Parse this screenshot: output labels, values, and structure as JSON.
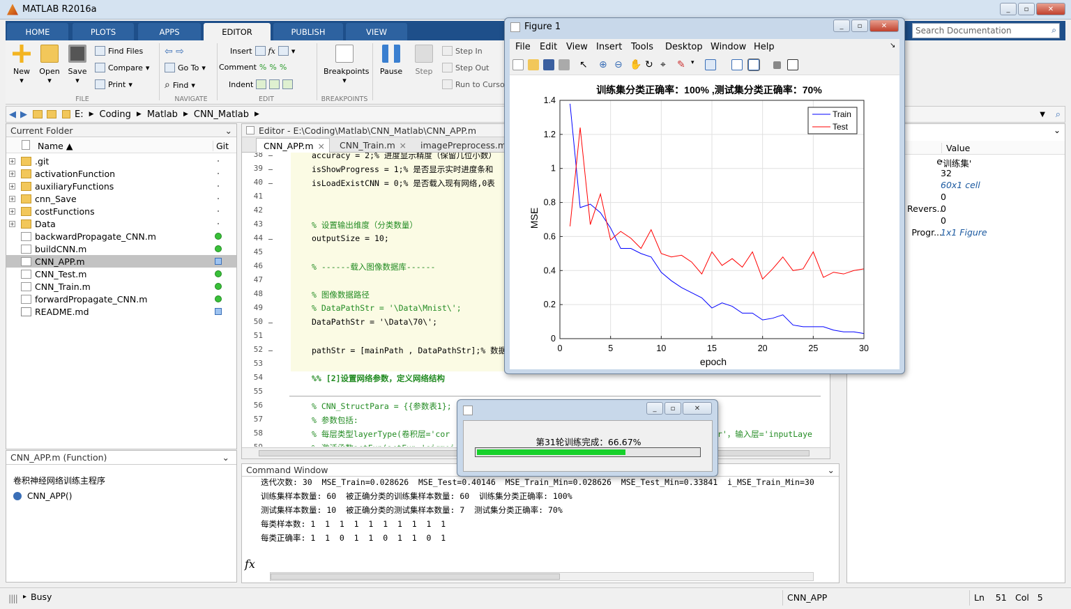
{
  "app": {
    "title": "MATLAB R2016a",
    "search_placeholder": "Search Documentation"
  },
  "ribbon": {
    "tabs": [
      "HOME",
      "PLOTS",
      "APPS",
      "EDITOR",
      "PUBLISH",
      "VIEW"
    ],
    "file": {
      "new": "New",
      "open": "Open",
      "save": "Save",
      "find_files": "Find Files",
      "compare": "Compare",
      "print": "Print",
      "label": "FILE"
    },
    "navigate": {
      "go_to": "Go To",
      "find": "Find",
      "label": "NAVIGATE"
    },
    "edit": {
      "insert": "Insert",
      "comment": "Comment",
      "indent": "Indent",
      "label": "EDIT"
    },
    "breakpoints": {
      "breakpoints": "Breakpoints",
      "label": "BREAKPOINTS"
    },
    "run": {
      "pause": "Pause",
      "step": "Step",
      "step_in": "Step In",
      "step_out": "Step Out",
      "run_to_cursor": "Run to Cursor"
    }
  },
  "address": {
    "parts": [
      "E:",
      "Coding",
      "Matlab",
      "CNN_Matlab"
    ]
  },
  "current_folder": {
    "title": "Current Folder",
    "col_name": "Name ▲",
    "col_git": "Git",
    "items": [
      {
        "name": ".git",
        "type": "folder",
        "git": "dot"
      },
      {
        "name": "activationFunction",
        "type": "folder",
        "git": "dot"
      },
      {
        "name": "auxiliaryFunctions",
        "type": "folder",
        "git": "dot"
      },
      {
        "name": "cnn_Save",
        "type": "folder",
        "git": "dot"
      },
      {
        "name": "costFunctions",
        "type": "folder",
        "git": "dot"
      },
      {
        "name": "Data",
        "type": "folder",
        "git": "dot"
      },
      {
        "name": "backwardPropagate_CNN.m",
        "type": "m",
        "git": "green"
      },
      {
        "name": "buildCNN.m",
        "type": "m",
        "git": "green"
      },
      {
        "name": "CNN_APP.m",
        "type": "m",
        "git": "blue",
        "selected": true
      },
      {
        "name": "CNN_Test.m",
        "type": "m",
        "git": "green"
      },
      {
        "name": "CNN_Train.m",
        "type": "m",
        "git": "green"
      },
      {
        "name": "forwardPropagate_CNN.m",
        "type": "m",
        "git": "green"
      },
      {
        "name": "README.md",
        "type": "md",
        "git": "blue"
      }
    ]
  },
  "details": {
    "title": "CNN_APP.m  (Function)",
    "description": "卷积神经网络训练主程序",
    "function": "CNN_APP()"
  },
  "editor": {
    "title": "Editor - E:\\Coding\\Matlab\\CNN_Matlab\\CNN_APP.m",
    "tabs": [
      "CNN_APP.m",
      "CNN_Train.m",
      "imagePreprocess.m"
    ],
    "lines": [
      {
        "n": "38",
        "code": "accuracy = 2;% 进度显示精度（保留几位小数）",
        "cls": "",
        "dash": true
      },
      {
        "n": "39",
        "code": "isShowProgress = 1;% 是否显示实时进度条和",
        "cls": "",
        "dash": true
      },
      {
        "n": "40",
        "code": "isLoadExistCNN = 0;% 是否载入现有网络,0表",
        "cls": "",
        "dash": true
      },
      {
        "n": "41",
        "code": "",
        "cls": "",
        "dash": false
      },
      {
        "n": "42",
        "code": "",
        "cls": "",
        "dash": false
      },
      {
        "n": "43",
        "code": "% 设置输出维度（分类数量）",
        "cls": "cm",
        "dash": false
      },
      {
        "n": "44",
        "code": "outputSize = 10;",
        "cls": "",
        "dash": true
      },
      {
        "n": "45",
        "code": "",
        "cls": "",
        "dash": false
      },
      {
        "n": "46",
        "code": "% ------载入图像数据库------",
        "cls": "cm",
        "dash": false
      },
      {
        "n": "47",
        "code": "",
        "cls": "",
        "dash": false
      },
      {
        "n": "48",
        "code": "% 图像数据路径",
        "cls": "cm",
        "dash": false
      },
      {
        "n": "49",
        "code": "% DataPathStr = '\\Data\\Mnist\\';",
        "cls": "cm",
        "dash": false
      },
      {
        "n": "50",
        "code": "DataPathStr = '\\Data\\70\\';",
        "cls": "mix",
        "dash": true
      },
      {
        "n": "51",
        "code": "",
        "cls": "",
        "dash": false
      },
      {
        "n": "52",
        "code": "pathStr = [mainPath , DataPathStr];% 数据",
        "cls": "",
        "dash": true
      },
      {
        "n": "53",
        "code": "",
        "cls": "",
        "dash": false
      },
      {
        "n": "54",
        "code": "%% [2]设置网络参数，定义网络结构",
        "cls": "cmb",
        "dash": false
      },
      {
        "n": "55",
        "code": "",
        "cls": "",
        "dash": false
      },
      {
        "n": "56",
        "code": "% CNN_StructPara = {{参数表1};",
        "cls": "cm",
        "dash": false
      },
      {
        "n": "57",
        "code": "% 参数包括:",
        "cls": "cm",
        "dash": false
      },
      {
        "n": "58",
        "code": "% 每层类型layerType(卷积层='cor",
        "cls": "cm",
        "dash": false
      },
      {
        "n": "59",
        "code": "% 激活函数actFun(actFun='sigmoi",
        "cls": "cm",
        "dash": false
      }
    ],
    "tail58": "er'，输入层='inputLaye"
  },
  "command_window": {
    "title": "Command Window",
    "lines": [
      "迭代次数: 30  MSE_Train=0.028626  MSE_Test=0.40146  MSE_Train_Min=0.028626  MSE_Test_Min=0.33841  i_MSE_Train_Min=30",
      "训练集样本数量: 60  被正确分类的训练集样本数量: 60  训练集分类正确率: 100%",
      "测试集样本数量: 10  被正确分类的测试集样本数量: 7  测试集分类正确率: 70%",
      "每类样本数: 1  1  1  1  1  1  1  1  1  1",
      "每类正确率: 1  1  0  1  1  0  1  1  0  1"
    ],
    "prompt": "fx"
  },
  "workspace": {
    "col_value": "Value",
    "rows": [
      {
        "name": "e",
        "value": "'训练集'",
        "italic": false
      },
      {
        "name": "",
        "value": "32",
        "italic": false
      },
      {
        "name": "",
        "value": "60x1 cell",
        "italic": true
      },
      {
        "name": "",
        "value": "0",
        "italic": false
      },
      {
        "name": "Revers...",
        "value": "0",
        "italic": false
      },
      {
        "name": "",
        "value": "0",
        "italic": false
      },
      {
        "name": "Progr...",
        "value": "1x1 Figure",
        "italic": true
      }
    ]
  },
  "figure": {
    "title": "Figure 1",
    "menu": [
      "File",
      "Edit",
      "View",
      "Insert",
      "Tools",
      "Desktop",
      "Window",
      "Help"
    ]
  },
  "progress": {
    "text": "第31轮训练完成：66.67%",
    "fraction": 0.6667
  },
  "status": {
    "state": "Busy",
    "func": "CNN_APP",
    "ln_label": "Ln",
    "ln": "51",
    "col_label": "Col",
    "col": "5"
  },
  "chart_data": {
    "type": "line",
    "title": "训练集分类正确率：100% ,测试集分类正确率：70%",
    "xlabel": "epoch",
    "ylabel": "MSE",
    "xlim": [
      0,
      30
    ],
    "ylim": [
      0,
      1.4
    ],
    "xticks": [
      0,
      5,
      10,
      15,
      20,
      25,
      30
    ],
    "yticks": [
      0,
      0.2,
      0.4,
      0.6,
      0.8,
      1,
      1.2,
      1.4
    ],
    "grid": true,
    "legend_position": "top-right",
    "x": [
      1,
      2,
      3,
      4,
      5,
      6,
      7,
      8,
      9,
      10,
      11,
      12,
      13,
      14,
      15,
      16,
      17,
      18,
      19,
      20,
      21,
      22,
      23,
      24,
      25,
      26,
      27,
      28,
      29,
      30
    ],
    "series": [
      {
        "name": "Train",
        "color": "#0000ff",
        "values": [
          1.38,
          0.77,
          0.79,
          0.74,
          0.65,
          0.53,
          0.53,
          0.5,
          0.48,
          0.39,
          0.34,
          0.3,
          0.27,
          0.24,
          0.18,
          0.21,
          0.19,
          0.15,
          0.15,
          0.11,
          0.12,
          0.14,
          0.08,
          0.07,
          0.07,
          0.07,
          0.05,
          0.04,
          0.04,
          0.03
        ]
      },
      {
        "name": "Test",
        "color": "#ff0000",
        "values": [
          0.66,
          1.24,
          0.67,
          0.85,
          0.58,
          0.63,
          0.59,
          0.53,
          0.64,
          0.5,
          0.48,
          0.49,
          0.45,
          0.38,
          0.51,
          0.43,
          0.47,
          0.42,
          0.51,
          0.35,
          0.41,
          0.48,
          0.4,
          0.41,
          0.51,
          0.36,
          0.39,
          0.38,
          0.4,
          0.41
        ]
      }
    ]
  }
}
